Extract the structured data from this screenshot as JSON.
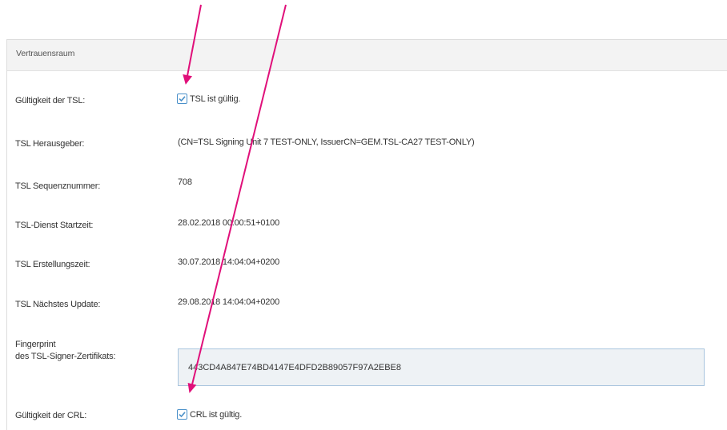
{
  "panel": {
    "title": "Vertrauensraum"
  },
  "rows": {
    "tsl_validity": {
      "label": "Gültigkeit der TSL:",
      "checkbox_label": "TSL ist gültig.",
      "checked": true
    },
    "tsl_issuer": {
      "label": "TSL Herausgeber:",
      "value": "(CN=TSL Signing Unit 7 TEST-ONLY, IssuerCN=GEM.TSL-CA27 TEST-ONLY)"
    },
    "tsl_sequence": {
      "label": "TSL Sequenznummer:",
      "value": "708"
    },
    "tsl_service_start": {
      "label": "TSL-Dienst Startzeit:",
      "value": "28.02.2018 00:00:51+0100"
    },
    "tsl_creation": {
      "label": "TSL Erstellungszeit:",
      "value": "30.07.2018 14:04:04+0200"
    },
    "tsl_next_update": {
      "label": "TSL Nächstes Update:",
      "value": "29.08.2018 14:04:04+0200"
    },
    "fingerprint": {
      "label_line1": "Fingerprint",
      "label_line2": "des TSL-Signer-Zertifikats:",
      "value": "443CD4A847E74BD4147E4DFD2B89057F97A2EBE8"
    },
    "crl_validity": {
      "label": "Gültigkeit der CRL:",
      "checkbox_label": "CRL ist gültig.",
      "checked": true
    }
  },
  "colors": {
    "annotation_arrow": "#e0107a",
    "checkbox_accent": "#4a90c9",
    "header_bg": "#f3f3f3",
    "field_bg": "#eef2f5"
  },
  "icons": {
    "checkbox": "checkmark-icon",
    "annotation": "arrow-icon"
  }
}
